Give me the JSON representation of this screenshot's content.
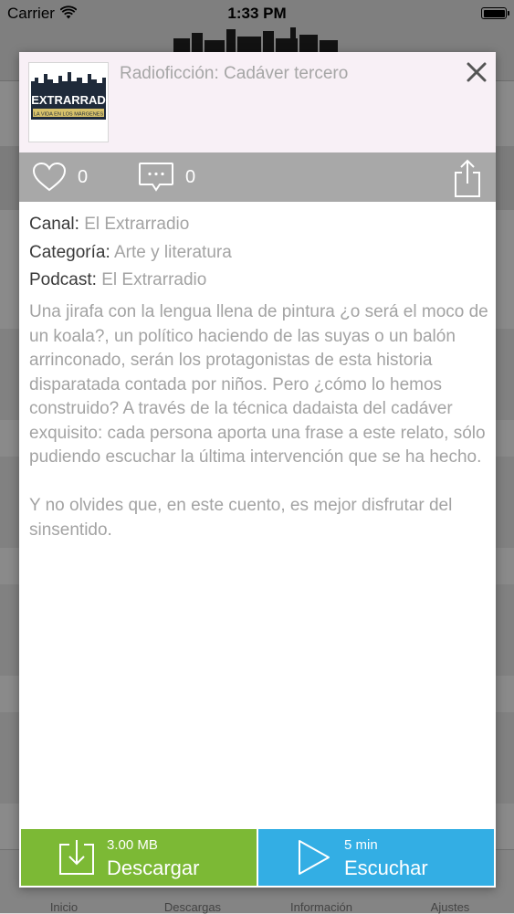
{
  "status_bar": {
    "carrier": "Carrier",
    "time": "1:33 PM"
  },
  "background_tabs": [
    {
      "label": "Inicio"
    },
    {
      "label": "Descargas"
    },
    {
      "label": "Información"
    },
    {
      "label": "Ajustes"
    }
  ],
  "episode": {
    "title": "Radioficción: Cadáver tercero",
    "thumbnail_text": "EXTRARRAD",
    "thumbnail_subtext": "LA VIDA EN LOS MÁRGENES",
    "likes": "0",
    "comments": "0"
  },
  "meta": {
    "canal_label": "Canal:",
    "canal_value": "El Extrarradio",
    "categoria_label": "Categoría:",
    "categoria_value": "Arte y literatura",
    "podcast_label": "Podcast:",
    "podcast_value": "El Extrarradio"
  },
  "description": "Una jirafa con la lengua llena de pintura ¿o será el moco de un koala?, un político haciendo de las suyas o un balón arrinconado, serán los protagonistas de esta historia disparatada contada por niños. Pero ¿cómo lo hemos construido? A través de la técnica dadaista del cadáver exquisito: cada persona aporta una frase a este relato, sólo pudiendo escuchar la última intervención que se ha hecho.\n\nY no olvides que, en este cuento, es mejor disfrutar del sinsentido.",
  "download": {
    "size": "3.00 MB",
    "label": "Descargar"
  },
  "listen": {
    "duration": "5 min",
    "label": "Escuchar"
  },
  "colors": {
    "download_green": "#7cb935",
    "listen_blue": "#33aee4",
    "action_bar_gray": "#a8a8a8",
    "header_tint": "#f8f0f6"
  },
  "icons": {
    "like": "heart-outline-icon",
    "comment": "speech-bubble-icon",
    "share": "share-icon",
    "close": "close-icon",
    "download": "download-tray-icon",
    "play": "play-icon"
  }
}
